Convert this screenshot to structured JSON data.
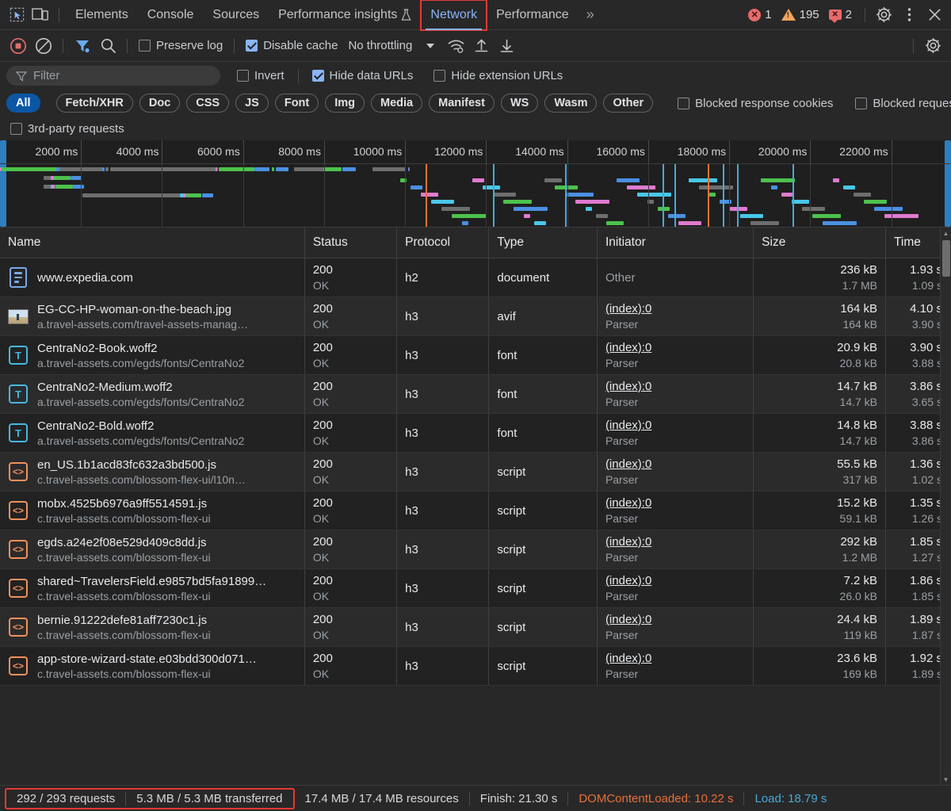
{
  "window": {
    "tab_icons": [
      "inspect-icon",
      "device-toolbar-icon"
    ],
    "tabs": [
      {
        "label": "Elements",
        "selected": false,
        "highlighted": false
      },
      {
        "label": "Console",
        "selected": false,
        "highlighted": false
      },
      {
        "label": "Sources",
        "selected": false,
        "highlighted": false
      },
      {
        "label": "Performance insights",
        "selected": false,
        "highlighted": false,
        "beta_icon": "flask-icon"
      },
      {
        "label": "Network",
        "selected": true,
        "highlighted": true
      },
      {
        "label": "Performance",
        "selected": false,
        "highlighted": false
      }
    ],
    "more_tabs_label": "»",
    "badges": {
      "errors": "1",
      "warnings": "195",
      "messages": "2"
    },
    "settings_label": "settings-gear-icon",
    "more_label": "more-options-icon",
    "close_label": "close-icon"
  },
  "toolbar": {
    "record_label": "record-button",
    "clear_label": "clear-button",
    "filter_label": "filter-toggle",
    "search_label": "search-button",
    "preserve_log": {
      "label": "Preserve log",
      "checked": false
    },
    "disable_cache": {
      "label": "Disable cache",
      "checked": true
    },
    "throttling": "No throttling",
    "network_conditions_label": "wifi-conditions-icon",
    "import_har_label": "import-har-icon",
    "export_har_label": "export-har-icon",
    "settings_label": "network-settings-icon"
  },
  "filters": {
    "placeholder": "Filter",
    "value": "",
    "invert": {
      "label": "Invert",
      "checked": false
    },
    "hide_data_urls": {
      "label": "Hide data URLs",
      "checked": true
    },
    "hide_extension_urls": {
      "label": "Hide extension URLs",
      "checked": false
    },
    "blocked_response_cookies": {
      "label": "Blocked response cookies",
      "checked": false
    },
    "blocked_requests": {
      "label": "Blocked requests",
      "checked": false
    },
    "third_party": {
      "label": "3rd-party requests",
      "checked": false
    },
    "types": [
      {
        "label": "All",
        "active": true
      },
      {
        "label": "Fetch/XHR",
        "active": false
      },
      {
        "label": "Doc",
        "active": false
      },
      {
        "label": "CSS",
        "active": false
      },
      {
        "label": "JS",
        "active": false
      },
      {
        "label": "Font",
        "active": false
      },
      {
        "label": "Img",
        "active": false
      },
      {
        "label": "Media",
        "active": false
      },
      {
        "label": "Manifest",
        "active": false
      },
      {
        "label": "WS",
        "active": false
      },
      {
        "label": "Wasm",
        "active": false
      },
      {
        "label": "Other",
        "active": false
      }
    ]
  },
  "overview": {
    "ticks": [
      "2000 ms",
      "4000 ms",
      "6000 ms",
      "8000 ms",
      "10000 ms",
      "12000 ms",
      "14000 ms",
      "16000 ms",
      "18000 ms",
      "20000 ms",
      "22000 ms"
    ],
    "dcl_marker_color": "#e8703a",
    "load_marker_color": "#4aa8d8"
  },
  "table": {
    "columns": [
      "Name",
      "Status",
      "Protocol",
      "Type",
      "Initiator",
      "Size",
      "Time"
    ],
    "rows": [
      {
        "icon": "document-file-icon",
        "name": "www.expedia.com",
        "domain": "",
        "status": "200",
        "status_text": "OK",
        "protocol": "h2",
        "type": "document",
        "initiator": "Other",
        "initiator_sub": "",
        "initiator_is_link": false,
        "size": "236 kB",
        "size_sub": "1.7 MB",
        "time": "1.93 s",
        "time_sub": "1.09 s"
      },
      {
        "icon": "image-file-icon",
        "name": "EG-CC-HP-woman-on-the-beach.jpg",
        "domain": "a.travel-assets.com/travel-assets-manag…",
        "status": "200",
        "status_text": "OK",
        "protocol": "h3",
        "type": "avif",
        "initiator": "(index):0",
        "initiator_sub": "Parser",
        "initiator_is_link": true,
        "size": "164 kB",
        "size_sub": "164 kB",
        "time": "4.10 s",
        "time_sub": "3.90 s"
      },
      {
        "icon": "font-file-icon",
        "name": "CentraNo2-Book.woff2",
        "domain": "a.travel-assets.com/egds/fonts/CentraNo2",
        "status": "200",
        "status_text": "OK",
        "protocol": "h3",
        "type": "font",
        "initiator": "(index):0",
        "initiator_sub": "Parser",
        "initiator_is_link": true,
        "size": "20.9 kB",
        "size_sub": "20.8 kB",
        "time": "3.90 s",
        "time_sub": "3.88 s"
      },
      {
        "icon": "font-file-icon",
        "name": "CentraNo2-Medium.woff2",
        "domain": "a.travel-assets.com/egds/fonts/CentraNo2",
        "status": "200",
        "status_text": "OK",
        "protocol": "h3",
        "type": "font",
        "initiator": "(index):0",
        "initiator_sub": "Parser",
        "initiator_is_link": true,
        "size": "14.7 kB",
        "size_sub": "14.7 kB",
        "time": "3.86 s",
        "time_sub": "3.65 s"
      },
      {
        "icon": "font-file-icon",
        "name": "CentraNo2-Bold.woff2",
        "domain": "a.travel-assets.com/egds/fonts/CentraNo2",
        "status": "200",
        "status_text": "OK",
        "protocol": "h3",
        "type": "font",
        "initiator": "(index):0",
        "initiator_sub": "Parser",
        "initiator_is_link": true,
        "size": "14.8 kB",
        "size_sub": "14.7 kB",
        "time": "3.88 s",
        "time_sub": "3.86 s"
      },
      {
        "icon": "script-file-icon",
        "name": "en_US.1b1acd83fc632a3bd500.js",
        "domain": "c.travel-assets.com/blossom-flex-ui/l10n…",
        "status": "200",
        "status_text": "OK",
        "protocol": "h3",
        "type": "script",
        "initiator": "(index):0",
        "initiator_sub": "Parser",
        "initiator_is_link": true,
        "size": "55.5 kB",
        "size_sub": "317 kB",
        "time": "1.36 s",
        "time_sub": "1.02 s"
      },
      {
        "icon": "script-file-icon",
        "name": "mobx.4525b6976a9ff5514591.js",
        "domain": "c.travel-assets.com/blossom-flex-ui",
        "status": "200",
        "status_text": "OK",
        "protocol": "h3",
        "type": "script",
        "initiator": "(index):0",
        "initiator_sub": "Parser",
        "initiator_is_link": true,
        "size": "15.2 kB",
        "size_sub": "59.1 kB",
        "time": "1.35 s",
        "time_sub": "1.26 s"
      },
      {
        "icon": "script-file-icon",
        "name": "egds.a24e2f08e529d409c8dd.js",
        "domain": "c.travel-assets.com/blossom-flex-ui",
        "status": "200",
        "status_text": "OK",
        "protocol": "h3",
        "type": "script",
        "initiator": "(index):0",
        "initiator_sub": "Parser",
        "initiator_is_link": true,
        "size": "292 kB",
        "size_sub": "1.2 MB",
        "time": "1.85 s",
        "time_sub": "1.27 s"
      },
      {
        "icon": "script-file-icon",
        "name": "shared~TravelersField.e9857bd5fa91899…",
        "domain": "c.travel-assets.com/blossom-flex-ui",
        "status": "200",
        "status_text": "OK",
        "protocol": "h3",
        "type": "script",
        "initiator": "(index):0",
        "initiator_sub": "Parser",
        "initiator_is_link": true,
        "size": "7.2 kB",
        "size_sub": "26.0 kB",
        "time": "1.86 s",
        "time_sub": "1.85 s"
      },
      {
        "icon": "script-file-icon",
        "name": "bernie.91222defe81aff7230c1.js",
        "domain": "c.travel-assets.com/blossom-flex-ui",
        "status": "200",
        "status_text": "OK",
        "protocol": "h3",
        "type": "script",
        "initiator": "(index):0",
        "initiator_sub": "Parser",
        "initiator_is_link": true,
        "size": "24.4 kB",
        "size_sub": "119 kB",
        "time": "1.89 s",
        "time_sub": "1.87 s"
      },
      {
        "icon": "script-file-icon",
        "name": "app-store-wizard-state.e03bdd300d071…",
        "domain": "c.travel-assets.com/blossom-flex-ui",
        "status": "200",
        "status_text": "OK",
        "protocol": "h3",
        "type": "script",
        "initiator": "(index):0",
        "initiator_sub": "Parser",
        "initiator_is_link": true,
        "size": "23.6 kB",
        "size_sub": "169 kB",
        "time": "1.92 s",
        "time_sub": "1.89 s"
      }
    ]
  },
  "status_bar": {
    "requests": "292 / 293 requests",
    "transferred": "5.3 MB / 5.3 MB transferred",
    "resources": "17.4 MB / 17.4 MB resources",
    "finish": "Finish: 21.30 s",
    "dom_content_loaded": "DOMContentLoaded: 10.22 s",
    "load": "Load: 18.79 s"
  },
  "colors": {
    "accent": "#8ab4f8",
    "highlight_box": "#e53935",
    "pill_active": "#0b57a4",
    "dcl": "#e8703a",
    "load": "#4aa8d8"
  }
}
